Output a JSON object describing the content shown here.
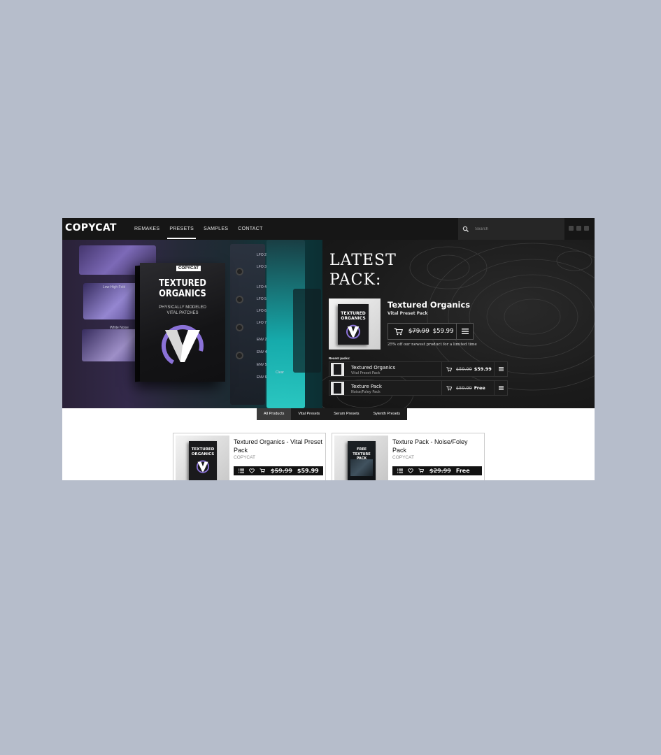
{
  "brand": {
    "logo": "COPYCAT"
  },
  "nav": {
    "links": [
      "REMAKES",
      "PRESETS",
      "SAMPLES",
      "CONTACT"
    ],
    "active": "PRESETS",
    "search_placeholder": "Search"
  },
  "hero": {
    "box": {
      "logo": "COPYCAT",
      "title_line1": "TEXTURED",
      "title_line2": "ORGANICS",
      "subtitle_line1": "PHYSICALLY MODELED",
      "subtitle_line2": "VITAL PATCHES"
    },
    "synth_labels": [
      "Low-High Fold",
      "White Noise",
      "LFO 2",
      "LFO 3",
      "LFO 4",
      "LFO 5",
      "LFO 6",
      "LFO 7",
      "ENV 2",
      "ENV 4",
      "ENV 5",
      "ENV 6",
      "Clear"
    ],
    "heading_line1": "LATEST",
    "heading_line2": "PACK:",
    "featured": {
      "title": "Textured Organics",
      "subtitle": "Vital Preset Pack",
      "old_price": "$79.99",
      "new_price": "$59.99",
      "promo": "25% off our newest product for a limited time"
    },
    "recent_label": "Recent packs:",
    "recent": [
      {
        "name": "Textured Organics",
        "sub": "Vital Preset Pack",
        "old_price": "$59.99",
        "new_price": "$59.99"
      },
      {
        "name": "Texture Pack",
        "sub": "Noise/Foley Pack",
        "old_price": "$59.99",
        "new_price": "Free"
      }
    ]
  },
  "tabs": [
    "All Products",
    "Vital Presets",
    "Serum Presets",
    "Sylenth Presets"
  ],
  "active_tab": "All Products",
  "products": [
    {
      "title": "Textured Organics - Vital Preset Pack",
      "brand": "COPYCAT",
      "old_price": "$59.99",
      "new_price": "$59.99",
      "box_title_1": "TEXTURED",
      "box_title_2": "ORGANICS"
    },
    {
      "title": "Texture Pack - Noise/Foley Pack",
      "brand": "COPYCAT",
      "old_price": "$29.99",
      "new_price": "Free",
      "box_title_1": "FREE",
      "box_title_2": "TEXTURE PACK"
    }
  ],
  "colors": {
    "page_bg": "#b6bdcb",
    "nav_bg": "#161616",
    "hero_accent_teal": "#17bfbf",
    "hero_accent_purple": "#8f7ad3"
  }
}
